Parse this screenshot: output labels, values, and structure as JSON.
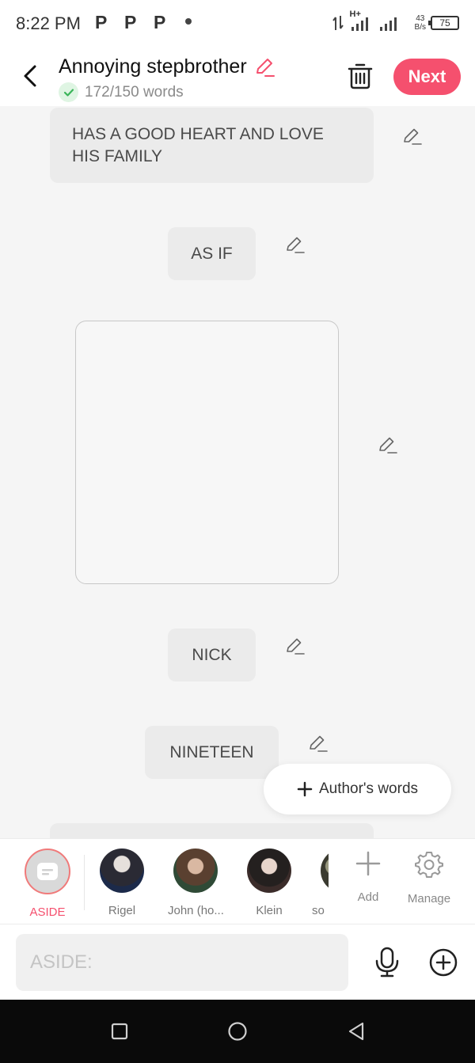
{
  "status_bar": {
    "time": "8:22 PM",
    "notification_icons": [
      "P",
      "P",
      "P"
    ],
    "network_label": "H+",
    "speed_value": "43",
    "speed_unit": "B/s",
    "battery": "75"
  },
  "header": {
    "title": "Annoying stepbrother",
    "word_count": "172/150 words",
    "next_label": "Next",
    "accent_color": "#f5506e"
  },
  "messages": [
    {
      "text": "HAS A GOOD HEART AND LOVE HIS FAMILY"
    },
    {
      "text": "AS IF"
    },
    {
      "text": "NICK"
    },
    {
      "text": "NINETEEN"
    }
  ],
  "author_words_label": "Author's words",
  "characters": [
    {
      "name": "ASIDE",
      "selected": true
    },
    {
      "name": "Rigel"
    },
    {
      "name": "John (ho..."
    },
    {
      "name": "Klein"
    },
    {
      "name": "so i"
    }
  ],
  "tools": {
    "add_label": "Add",
    "manage_label": "Manage"
  },
  "input": {
    "placeholder": "ASIDE:"
  }
}
